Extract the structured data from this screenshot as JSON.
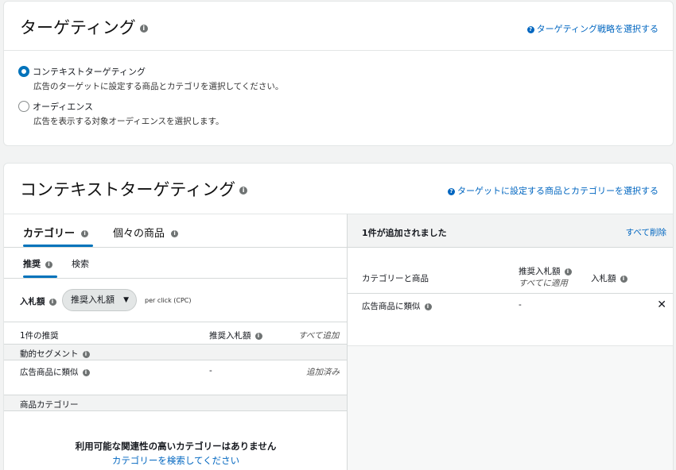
{
  "targeting": {
    "title": "ターゲティング",
    "help_link": "ターゲティング戦略を選択する",
    "options": [
      {
        "label": "コンテキストターゲティング",
        "desc": "広告のターゲットに設定する商品とカテゴリを選択してください。",
        "selected": true
      },
      {
        "label": "オーディエンス",
        "desc": "広告を表示する対象オーディエンスを選択します。",
        "selected": false
      }
    ]
  },
  "contextual": {
    "title": "コンテキストターゲティング",
    "help_link": "ターゲットに設定する商品とカテゴリーを選択する",
    "tabs": [
      "カテゴリー",
      "個々の商品"
    ],
    "subtabs": [
      "推奨",
      "検索"
    ],
    "bid": {
      "label": "入札額",
      "select_value": "推奨入札額",
      "unit": "per click (CPC)"
    },
    "table": {
      "count_label": "1件の推奨",
      "col_bid": "推奨入札額",
      "add_all": "すべて追加",
      "group_dynamic": "動的セグメント",
      "row_name": "広告商品に類似",
      "row_bid": "-",
      "row_status": "追加済み",
      "group_category": "商品カテゴリー"
    },
    "empty": {
      "title": "利用可能な関連性の高いカテゴリーはありません",
      "link": "カテゴリーを検索してください"
    }
  },
  "added": {
    "title": "1件が追加されました",
    "clear_all": "すべて削除",
    "col_name": "カテゴリーと商品",
    "col_suggested": "推奨入札額",
    "col_apply_all": "すべてに適用",
    "col_bid": "入札額",
    "row_name": "広告商品に類似",
    "row_suggested": "-"
  },
  "icons": {
    "info": "i",
    "help": "?",
    "close": "✕",
    "chevron": "⌄"
  }
}
